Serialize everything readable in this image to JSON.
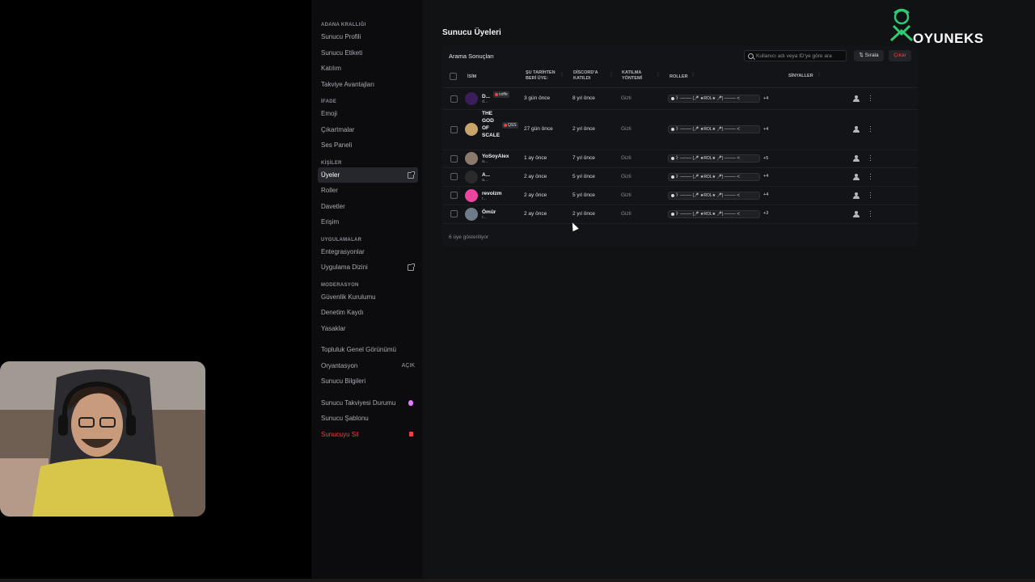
{
  "sidebar": {
    "sections": [
      {
        "title": "ADANA KRALLIĞI",
        "items": [
          {
            "label": "Sunucu Profili"
          },
          {
            "label": "Sunucu Etiketi"
          },
          {
            "label": "Katılım"
          },
          {
            "label": "Takviye Avantajları"
          }
        ]
      },
      {
        "title": "İFADE",
        "items": [
          {
            "label": "Emoji"
          },
          {
            "label": "Çıkartmalar"
          },
          {
            "label": "Ses Paneli"
          }
        ]
      },
      {
        "title": "KİŞİLER",
        "items": [
          {
            "label": "Üyeler",
            "active": true,
            "icon": "external-link-icon"
          },
          {
            "label": "Roller"
          },
          {
            "label": "Davetler"
          },
          {
            "label": "Erişim"
          }
        ]
      },
      {
        "title": "UYGULAMALAR",
        "items": [
          {
            "label": "Entegrasyonlar"
          },
          {
            "label": "Uygulama Dizini",
            "icon": "external-link-icon"
          }
        ]
      },
      {
        "title": "MODERASYON",
        "items": [
          {
            "label": "Güvenlik Kurulumu"
          },
          {
            "label": "Denetim Kaydı"
          },
          {
            "label": "Yasaklar"
          }
        ]
      }
    ],
    "extra_items": [
      {
        "label": "Topluluk Genel Görünümü"
      },
      {
        "label": "Oryantasyon",
        "trail": "AÇIK"
      },
      {
        "label": "Sunucu Bilgileri"
      }
    ],
    "bottom_items": [
      {
        "label": "Sunucu Takviyesi Durumu",
        "icon": "boost-gem-icon"
      },
      {
        "label": "Sunucu Şablonu"
      },
      {
        "label": "Sunucuyu Sil",
        "icon": "trash-icon",
        "danger": true
      }
    ]
  },
  "main": {
    "title": "Sunucu Üyeleri",
    "card_title": "Arama Sonuçları",
    "search_placeholder": "Kullanıcı adı veya ID'ye göre ara",
    "sort_label": "Sırala",
    "kick_label": "Çıkar",
    "columns": {
      "name": "İSİM",
      "member_since_1": "ŞU TARİHTEN",
      "member_since_2": "BERİ ÜYE:",
      "joined_discord_1": "DİSCORD'A",
      "joined_discord_2": "KATILDI",
      "join_method_1": "KATILMA",
      "join_method_2": "YÖNTEMİ",
      "roles": "ROLLER",
      "signals": "SİNYALLER"
    },
    "members": [
      {
        "name": "D...",
        "sub": "d...",
        "tag": "coffe",
        "member_since": "3 gün önce",
        "joined_discord": "8 yıl önce",
        "join_method": "Gizli",
        "role": "》──── {🎤 ★ROL★ 🎤} ──── ᐸ",
        "extra": "+4",
        "avatar_color": "#3b1d5c"
      },
      {
        "name": "THE GOD OF SCALE",
        "sub": "...",
        "tag": "QSS",
        "member_since": "27 gün önce",
        "joined_discord": "2 yıl önce",
        "join_method": "Gizli",
        "role": "》──── {🎤 ★ROL★ 🎤} ──── ᐸ",
        "extra": "+4",
        "avatar_color": "#c9a46a"
      },
      {
        "name": "YoSoyAlex",
        "sub": "a...",
        "tag": "",
        "member_since": "1 ay önce",
        "joined_discord": "7 yıl önce",
        "join_method": "Gizli",
        "role": "》──── {🎤 ★ROL★ 🎤} ──── ᐸ",
        "extra": "+5",
        "avatar_color": "#8a7a6e"
      },
      {
        "name": "A...",
        "sub": "a...",
        "tag": "",
        "member_since": "2 ay önce",
        "joined_discord": "5 yıl önce",
        "join_method": "Gizli",
        "role": "》──── {🎤 ★ROL★ 🎤} ──── ᐸ",
        "extra": "+4",
        "avatar_color": "#2a2a2a"
      },
      {
        "name": "revolzm",
        "sub": "r...",
        "tag": "",
        "member_since": "2 ay önce",
        "joined_discord": "5 yıl önce",
        "join_method": "Gizli",
        "role": "》──── {🎤 ★ROL★ 🎤} ──── ᐸ",
        "extra": "+4",
        "avatar_color": "#eb459f"
      },
      {
        "name": "Ömür",
        "sub": "r...",
        "tag": "",
        "member_since": "2 ay önce",
        "joined_discord": "2 yıl önce",
        "join_method": "Gizli",
        "role": "》──── {🎤 ★ROL★ 🎤} ──── ᐸ",
        "extra": "+3",
        "avatar_color": "#6e7b8a"
      }
    ],
    "footer": "6 üye gösteriliyor"
  },
  "overlay": {
    "logo_text": "OYUNEKS",
    "logo_color": "#2ecc71"
  }
}
